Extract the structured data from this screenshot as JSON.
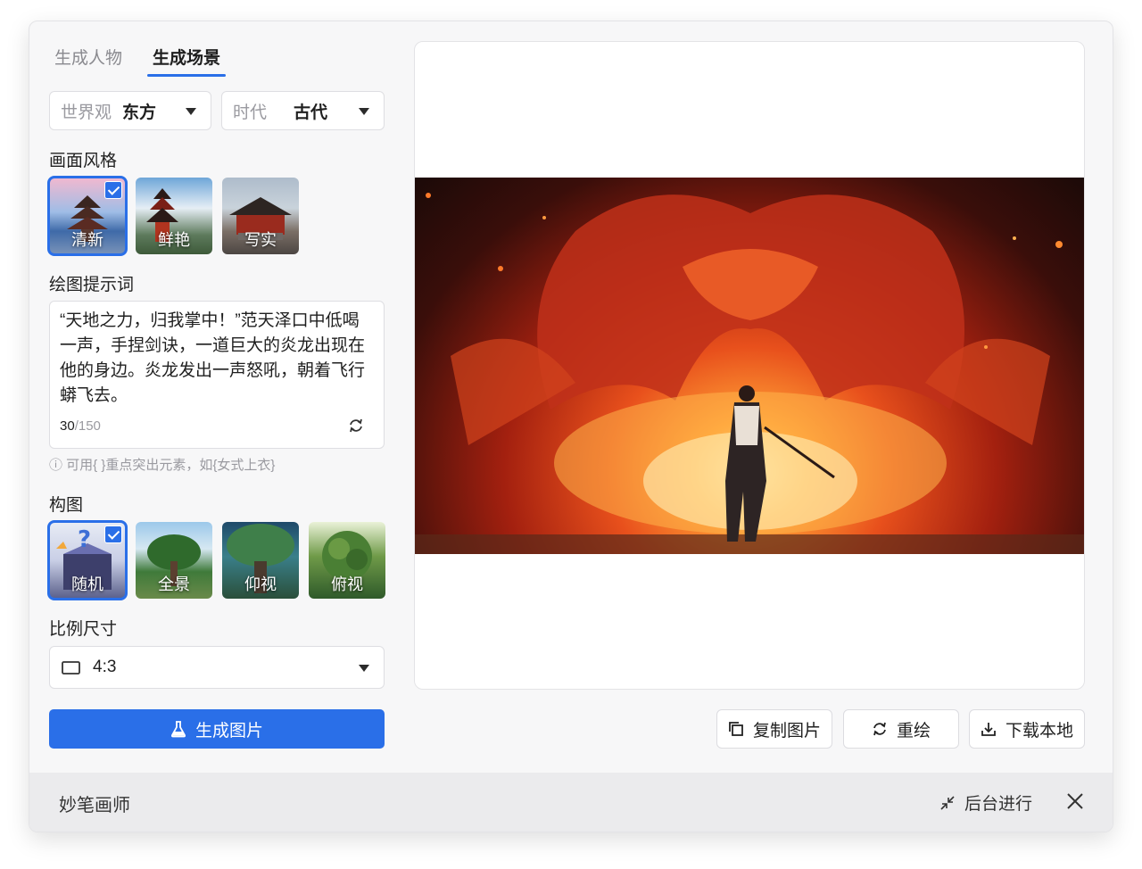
{
  "tabs": [
    {
      "label": "生成人物"
    },
    {
      "label": "生成场景"
    }
  ],
  "filters": {
    "worldview": {
      "label": "世界观",
      "value": "东方"
    },
    "era": {
      "label": "时代",
      "value": "古代"
    }
  },
  "style": {
    "label": "画面风格",
    "options": [
      {
        "caption": "清新",
        "selected": true
      },
      {
        "caption": "鲜艳"
      },
      {
        "caption": "写实"
      }
    ]
  },
  "prompt": {
    "label": "绘图提示词",
    "text": "“天地之力，归我掌中！”范天泽口中低喝一声，手捏剑诀，一道巨大的炎龙出现在他的身边。炎龙发出一声怒吼，朝着飞行蟒飞去。",
    "count": "30",
    "max": "/150",
    "hint": "ⓘ 可用{ }重点突出元素，如{女式上衣}"
  },
  "composition": {
    "label": "构图",
    "options": [
      {
        "caption": "随机",
        "selected": true
      },
      {
        "caption": "全景"
      },
      {
        "caption": "仰视"
      },
      {
        "caption": "俯视"
      }
    ]
  },
  "ratio": {
    "label": "比例尺寸",
    "value": "4:3"
  },
  "actions": {
    "generate": "生成图片",
    "copy": "复制图片",
    "redraw": "重绘",
    "download": "下载本地"
  },
  "footer": {
    "title": "妙笔画师",
    "background": "后台进行"
  }
}
